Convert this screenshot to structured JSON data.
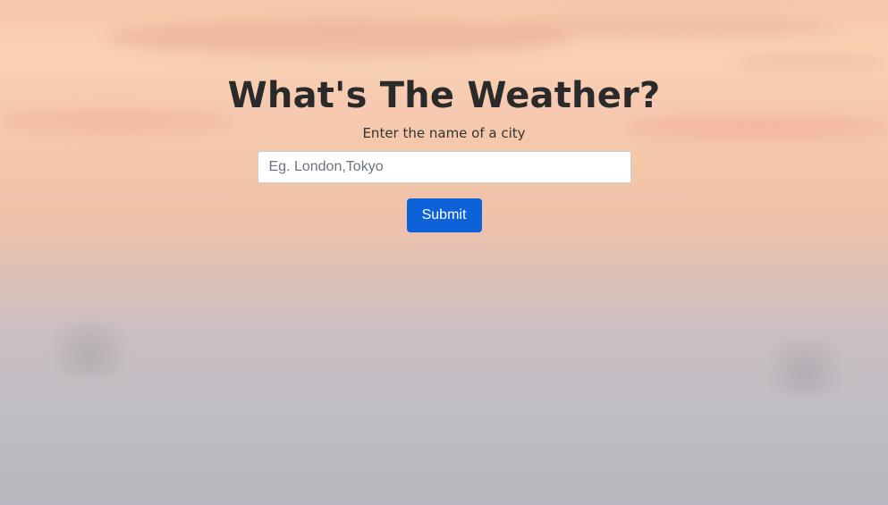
{
  "page": {
    "title": "What's The Weather?",
    "subtitle": "Enter the name of a city"
  },
  "form": {
    "city_placeholder": "Eg. London,Tokyo",
    "city_value": "",
    "submit_label": "Submit"
  },
  "colors": {
    "accent": "#0d62d9",
    "heading": "#2a2a2a"
  }
}
